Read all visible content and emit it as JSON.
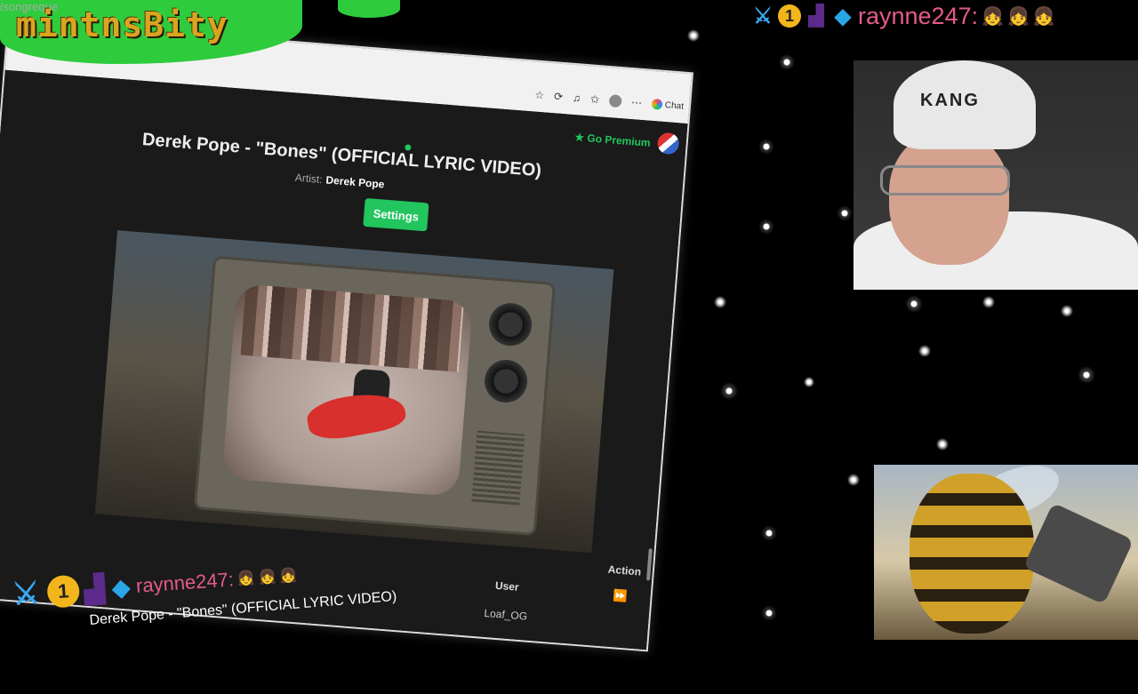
{
  "overlay": {
    "logo_text": "mintnsBity",
    "url_fragment": "/songreque"
  },
  "top_chat": {
    "username": "raynne247:",
    "emotes": "👧👧👧",
    "badges": [
      "sword-badge",
      "one-badge",
      "boot-badge",
      "cube-badge"
    ]
  },
  "browser": {
    "chat_button": "Chat"
  },
  "page": {
    "go_premium": "Go Premium",
    "song_title": "Derek Pope - \"Bones\" (OFFICIAL LYRIC VIDEO)",
    "artist_label": "Artist:",
    "artist_name": "Derek Pope",
    "settings_label": "Settings",
    "table": {
      "columns": [
        "User",
        "Action"
      ],
      "rows": [
        {
          "user": "Loaf_OG",
          "action": "⏩"
        }
      ]
    }
  },
  "bottom_chat": {
    "username": "raynne247:",
    "emotes": "👧👧👧",
    "badges": [
      "sword-badge",
      "one-badge",
      "boot-badge",
      "cube-badge"
    ]
  },
  "now_playing": "Derek Pope - \"Bones\" (OFFICIAL LYRIC VIDEO)",
  "webcam": {
    "beanie_text": "KANG"
  },
  "colors": {
    "accent_green": "#22c55e",
    "username_pink": "#e35a8c",
    "logo_gold": "#d9a521"
  }
}
